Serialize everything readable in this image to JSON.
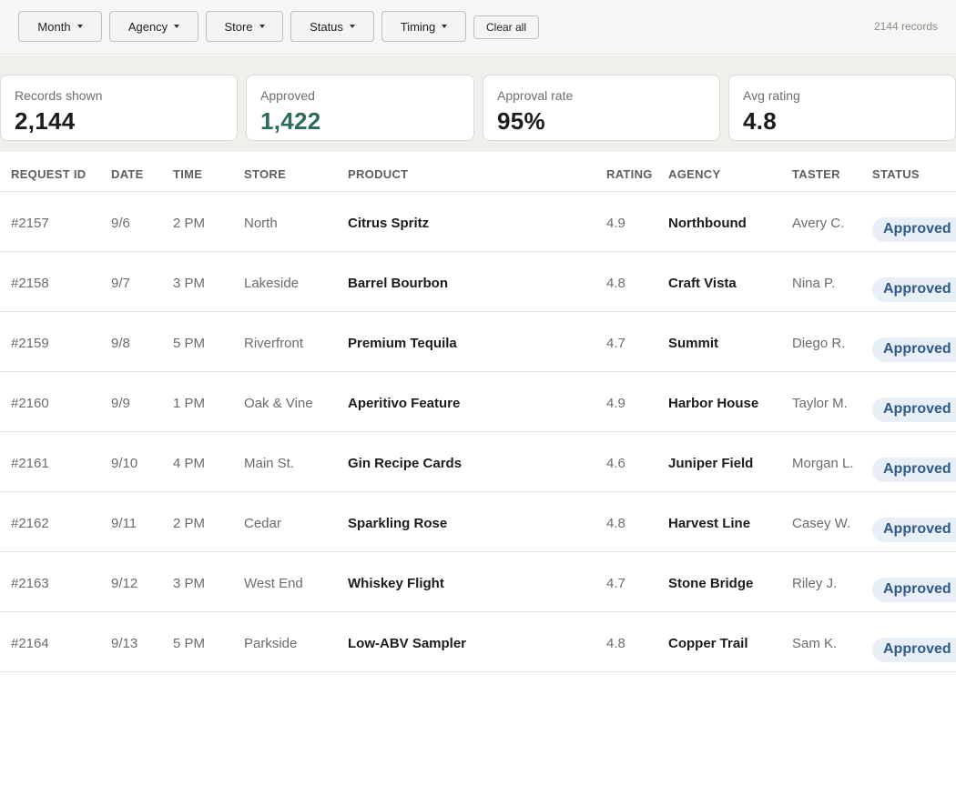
{
  "filters": {
    "chips": [
      "Month",
      "Agency",
      "Store",
      "Status",
      "Timing"
    ],
    "clear_label": "Clear all",
    "record_count": "2144 records"
  },
  "stats": [
    {
      "label": "Records shown",
      "value": "2,144"
    },
    {
      "label": "Approved",
      "value": "1,422",
      "accent": "#2d6b5a"
    },
    {
      "label": "Approval rate",
      "value": "95%"
    },
    {
      "label": "Avg rating",
      "value": "4.8"
    }
  ],
  "table": {
    "columns": [
      "REQUEST ID",
      "DATE",
      "TIME",
      "STORE",
      "PRODUCT",
      "RATING",
      "AGENCY",
      "TASTER",
      "STATUS"
    ],
    "rows": [
      [
        "#2157",
        "9/6",
        "2 PM",
        "North",
        "Citrus Spritz",
        "4.9",
        "Northbound",
        "Avery C.",
        "Approved"
      ],
      [
        "#2158",
        "9/7",
        "3 PM",
        "Lakeside",
        "Barrel Bourbon",
        "4.8",
        "Craft Vista",
        "Nina P.",
        "Approved"
      ],
      [
        "#2159",
        "9/8",
        "5 PM",
        "Riverfront",
        "Premium Tequila",
        "4.7",
        "Summit",
        "Diego R.",
        "Approved"
      ],
      [
        "#2160",
        "9/9",
        "1 PM",
        "Oak & Vine",
        "Aperitivo Feature",
        "4.9",
        "Harbor House",
        "Taylor M.",
        "Approved"
      ],
      [
        "#2161",
        "9/10",
        "4 PM",
        "Main St.",
        "Gin Recipe Cards",
        "4.6",
        "Juniper Field",
        "Morgan L.",
        "Approved"
      ],
      [
        "#2162",
        "9/11",
        "2 PM",
        "Cedar",
        "Sparkling Rose",
        "4.8",
        "Harvest Line",
        "Casey W.",
        "Approved"
      ],
      [
        "#2163",
        "9/12",
        "3 PM",
        "West End",
        "Whiskey Flight",
        "4.7",
        "Stone Bridge",
        "Riley J.",
        "Approved"
      ],
      [
        "#2164",
        "9/13",
        "5 PM",
        "Parkside",
        "Low-ABV Sampler",
        "4.8",
        "Copper Trail",
        "Sam K.",
        "Approved"
      ]
    ]
  },
  "colors": {
    "approved_badge_bg": "#e9eff7",
    "approved_badge_text": "#2e5b8a",
    "approved_stat": "#2d6b5a"
  }
}
